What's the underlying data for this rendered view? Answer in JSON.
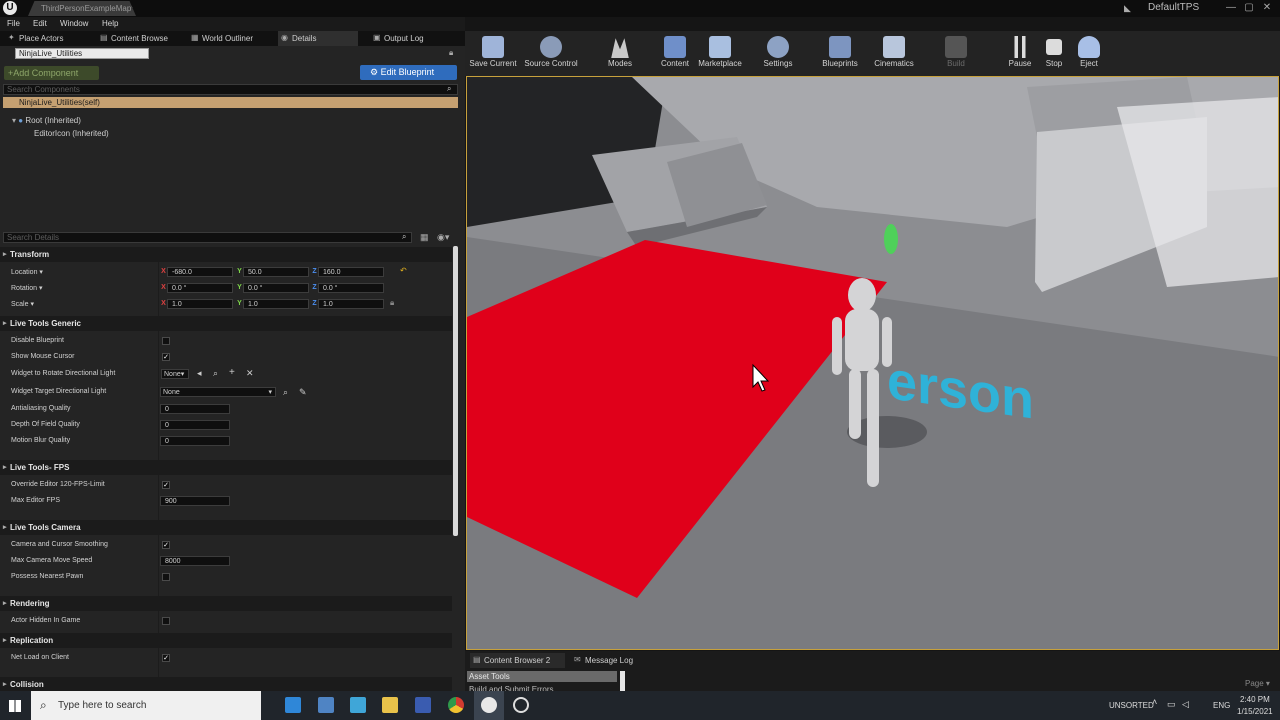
{
  "window": {
    "doc_tab": "ThirdPersonExampleMap*",
    "project": "DefaultTPS",
    "menu": [
      "File",
      "Edit",
      "Window",
      "Help"
    ]
  },
  "panel_tabs": {
    "place_actors": "Place Actors",
    "content_browser": "Content Browse",
    "world_outliner": "World Outliner",
    "details": "Details",
    "output_log": "Output Log"
  },
  "components": {
    "actor_name": "NinjaLive_Utilities",
    "add_component": "+Add Component",
    "edit_blueprint": "Edit Blueprint",
    "search_placeholder": "Search Components",
    "self_item": "NinjaLive_Utilities(self)",
    "root_item": "Root (Inherited)",
    "child_item": "EditorIcon (Inherited)"
  },
  "details": {
    "search_placeholder": "Search Details",
    "transform": {
      "header": "Transform",
      "location_label": "Location",
      "rotation_label": "Rotation",
      "scale_label": "Scale",
      "axis_x": "X",
      "axis_y": "Y",
      "axis_z": "Z",
      "location": [
        "-680.0",
        "50.0",
        "160.0"
      ],
      "rotation": [
        "0.0 °",
        "0.0 °",
        "0.0 °"
      ],
      "scale": [
        "1.0",
        "1.0",
        "1.0"
      ]
    },
    "live_tools_generic": {
      "header": "Live Tools Generic",
      "disable_blueprint": "Disable Blueprint",
      "show_mouse_cursor": "Show Mouse Cursor",
      "widget_rotate": "Widget to Rotate Directional Light",
      "widget_rotate_value": "None",
      "widget_target": "Widget Target Directional Light",
      "widget_target_value": "None",
      "antialiasing": "Antialiasing Quality",
      "antialiasing_value": "0",
      "dof": "Depth Of Field Quality",
      "dof_value": "0",
      "motion_blur": "Motion Blur Quality",
      "motion_blur_value": "0"
    },
    "live_tools_fps": {
      "header": "Live Tools- FPS",
      "override": "Override Editor 120-FPS-Limit",
      "max_fps": "Max Editor FPS",
      "max_fps_value": "900"
    },
    "live_tools_camera": {
      "header": "Live Tools Camera",
      "smoothing": "Camera and Cursor Smoothing",
      "move_speed": "Max Camera Move Speed",
      "move_speed_value": "8000",
      "possess": "Possess Nearest Pawn"
    },
    "rendering": {
      "header": "Rendering",
      "hidden": "Actor Hidden In Game"
    },
    "replication": {
      "header": "Replication",
      "net_load": "Net Load on Client"
    },
    "collision": {
      "header": "Collision"
    }
  },
  "toolbar": [
    {
      "label": "Save Current",
      "icon": "save-icon",
      "color": "#9fb4d9"
    },
    {
      "label": "Source Control",
      "icon": "source-control-icon",
      "color": "#8a9bb8"
    },
    {
      "label": "Modes",
      "icon": "modes-icon",
      "color": "#c9c9c9"
    },
    {
      "label": "Content",
      "icon": "content-icon",
      "color": "#6f8fc9"
    },
    {
      "label": "Marketplace",
      "icon": "marketplace-icon",
      "color": "#a9bfe0"
    },
    {
      "label": "Settings",
      "icon": "settings-icon",
      "color": "#8da2c4"
    },
    {
      "label": "Blueprints",
      "icon": "blueprints-icon",
      "color": "#7d95c0"
    },
    {
      "label": "Cinematics",
      "icon": "cinematics-icon",
      "color": "#b8c6dc"
    },
    {
      "label": "Build",
      "icon": "build-icon",
      "color": "#555555"
    },
    {
      "label": "Pause",
      "icon": "pause-icon",
      "color": "#dcdcdc"
    },
    {
      "label": "Stop",
      "icon": "stop-icon",
      "color": "#dcdcdc"
    },
    {
      "label": "Eject",
      "icon": "eject-icon",
      "color": "#a8bfe6"
    }
  ],
  "viewport": {
    "floor_text": "erson",
    "cursor": "mouse-cursor-icon"
  },
  "bottom": {
    "tab1": "Content Browser 2",
    "tab2": "Message Log",
    "asset_tools": "Asset Tools",
    "build_submit": "Build and Submit Errors",
    "page": "Page"
  },
  "taskbar": {
    "search_placeholder": "Type here to search",
    "unsorted": "UNSORTED",
    "lang": "ENG",
    "time": "2:40 PM",
    "date": "1/15/2021"
  },
  "colors": {
    "accent": "#2f6cbd",
    "selection": "#c5a071",
    "red_plane": "#e0001a",
    "viewport_border": "#c7a13c"
  }
}
